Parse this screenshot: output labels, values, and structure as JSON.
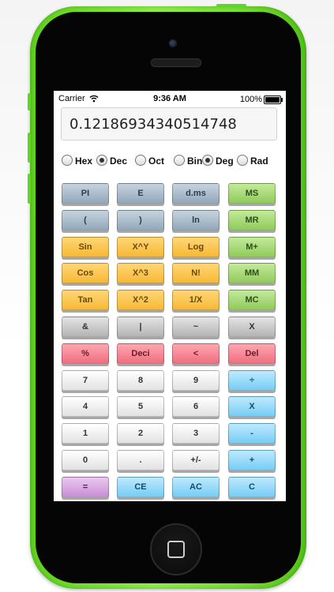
{
  "status": {
    "carrier": "Carrier",
    "time": "9:36 AM",
    "battery": "100%"
  },
  "display": {
    "value": "0.12186934340514748"
  },
  "modes": [
    {
      "label": "Hex",
      "checked": false
    },
    {
      "label": "Dec",
      "checked": true
    },
    {
      "label": "Oct",
      "checked": false
    },
    {
      "label": "Bin",
      "checked": false
    },
    {
      "label": "Deg",
      "checked": true
    },
    {
      "label": "Rad",
      "checked": false
    }
  ],
  "keys": [
    [
      {
        "label": "PI",
        "color": "steel",
        "name": "pi-key"
      },
      {
        "label": "E",
        "color": "steel",
        "name": "e-key"
      },
      {
        "label": "d.ms",
        "color": "steel",
        "name": "dms-key"
      },
      {
        "label": "MS",
        "color": "green",
        "name": "memory-store-key"
      }
    ],
    [
      {
        "label": "(",
        "color": "steel",
        "name": "open-paren-key"
      },
      {
        "label": ")",
        "color": "steel",
        "name": "close-paren-key"
      },
      {
        "label": "ln",
        "color": "steel",
        "name": "ln-key"
      },
      {
        "label": "MR",
        "color": "green",
        "name": "memory-recall-key"
      }
    ],
    [
      {
        "label": "Sin",
        "color": "orange",
        "name": "sin-key"
      },
      {
        "label": "X^Y",
        "color": "orange",
        "name": "power-key"
      },
      {
        "label": "Log",
        "color": "orange",
        "name": "log-key"
      },
      {
        "label": "M+",
        "color": "green",
        "name": "memory-add-key"
      }
    ],
    [
      {
        "label": "Cos",
        "color": "orange",
        "name": "cos-key"
      },
      {
        "label": "X^3",
        "color": "orange",
        "name": "cube-key"
      },
      {
        "label": "N!",
        "color": "orange",
        "name": "factorial-key"
      },
      {
        "label": "MM",
        "color": "green",
        "name": "memory-minus-key"
      }
    ],
    [
      {
        "label": "Tan",
        "color": "orange",
        "name": "tan-key"
      },
      {
        "label": "X^2",
        "color": "orange",
        "name": "square-key"
      },
      {
        "label": "1/X",
        "color": "orange",
        "name": "reciprocal-key"
      },
      {
        "label": "MC",
        "color": "green",
        "name": "memory-clear-key"
      }
    ],
    [
      {
        "label": "&",
        "color": "gray",
        "name": "and-key"
      },
      {
        "label": "|",
        "color": "gray",
        "name": "or-key"
      },
      {
        "label": "~",
        "color": "gray",
        "name": "not-key"
      },
      {
        "label": "X",
        "color": "gray",
        "name": "xor-key"
      }
    ],
    [
      {
        "label": "%",
        "color": "red",
        "name": "percent-key"
      },
      {
        "label": "Deci",
        "color": "red",
        "name": "deci-key"
      },
      {
        "label": "<",
        "color": "red",
        "name": "backspace-key"
      },
      {
        "label": "Del",
        "color": "red",
        "name": "delete-key"
      }
    ],
    [
      {
        "label": "7",
        "color": "white",
        "name": "digit-7-key"
      },
      {
        "label": "8",
        "color": "white",
        "name": "digit-8-key"
      },
      {
        "label": "9",
        "color": "white",
        "name": "digit-9-key"
      },
      {
        "label": "÷",
        "color": "blue",
        "name": "divide-key"
      }
    ],
    [
      {
        "label": "4",
        "color": "white",
        "name": "digit-4-key"
      },
      {
        "label": "5",
        "color": "white",
        "name": "digit-5-key"
      },
      {
        "label": "6",
        "color": "white",
        "name": "digit-6-key"
      },
      {
        "label": "X",
        "color": "blue",
        "name": "multiply-key"
      }
    ],
    [
      {
        "label": "1",
        "color": "white",
        "name": "digit-1-key"
      },
      {
        "label": "2",
        "color": "white",
        "name": "digit-2-key"
      },
      {
        "label": "3",
        "color": "white",
        "name": "digit-3-key"
      },
      {
        "label": "-",
        "color": "blue",
        "name": "subtract-key"
      }
    ],
    [
      {
        "label": "0",
        "color": "white",
        "name": "digit-0-key"
      },
      {
        "label": ".",
        "color": "white",
        "name": "decimal-point-key"
      },
      {
        "label": "+/-",
        "color": "white",
        "name": "negate-key"
      },
      {
        "label": "+",
        "color": "blue",
        "name": "add-key"
      }
    ],
    [
      {
        "label": "=",
        "color": "purple",
        "name": "equals-key"
      },
      {
        "label": "CE",
        "color": "blue",
        "name": "clear-entry-key"
      },
      {
        "label": "AC",
        "color": "blue",
        "name": "all-clear-key"
      },
      {
        "label": "C",
        "color": "blue",
        "name": "clear-key"
      }
    ]
  ]
}
